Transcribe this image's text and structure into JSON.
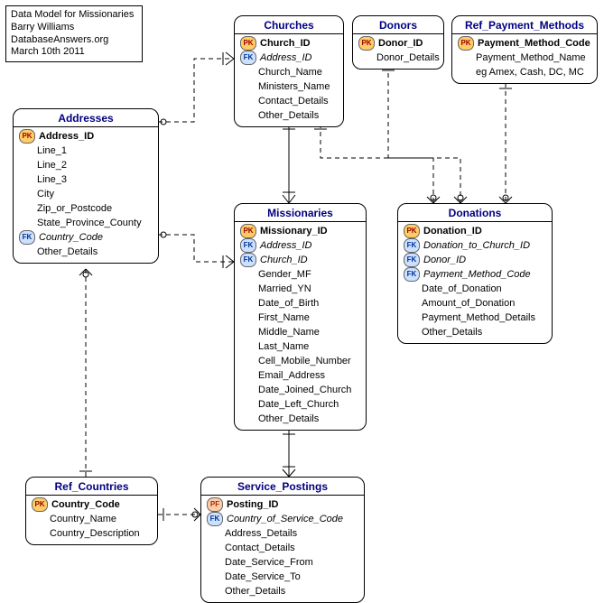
{
  "info": {
    "line1": "Data Model for Missionaries",
    "line2": "Barry Williams",
    "line3": "DatabaseAnswers.org",
    "line4": "March 10th 2011"
  },
  "entities": {
    "churches": {
      "title": "Churches",
      "attrs": [
        {
          "key": "pk",
          "label": "Church_ID",
          "bold": true
        },
        {
          "key": "fk",
          "label": "Address_ID",
          "italic": true
        },
        {
          "key": "",
          "label": "Church_Name"
        },
        {
          "key": "",
          "label": "Ministers_Name"
        },
        {
          "key": "",
          "label": "Contact_Details"
        },
        {
          "key": "",
          "label": "Other_Details"
        }
      ]
    },
    "donors": {
      "title": "Donors",
      "attrs": [
        {
          "key": "pk",
          "label": "Donor_ID",
          "bold": true
        },
        {
          "key": "",
          "label": "Donor_Details"
        }
      ]
    },
    "ref_payment": {
      "title": "Ref_Payment_Methods",
      "attrs": [
        {
          "key": "pk",
          "label": "Payment_Method_Code",
          "bold": true
        },
        {
          "key": "",
          "label": "Payment_Method_Name"
        },
        {
          "key": "",
          "label": "eg Amex, Cash, DC, MC"
        }
      ]
    },
    "addresses": {
      "title": "Addresses",
      "attrs": [
        {
          "key": "pk",
          "label": "Address_ID",
          "bold": true
        },
        {
          "key": "",
          "label": "Line_1"
        },
        {
          "key": "",
          "label": "Line_2"
        },
        {
          "key": "",
          "label": "Line_3"
        },
        {
          "key": "",
          "label": "City"
        },
        {
          "key": "",
          "label": "Zip_or_Postcode"
        },
        {
          "key": "",
          "label": "State_Province_County"
        },
        {
          "key": "fk",
          "label": "Country_Code",
          "italic": true
        },
        {
          "key": "",
          "label": "Other_Details"
        }
      ]
    },
    "missionaries": {
      "title": "Missionaries",
      "attrs": [
        {
          "key": "pk",
          "label": "Missionary_ID",
          "bold": true
        },
        {
          "key": "fk",
          "label": "Address_ID",
          "italic": true
        },
        {
          "key": "fk",
          "label": "Church_ID",
          "italic": true
        },
        {
          "key": "",
          "label": "Gender_MF"
        },
        {
          "key": "",
          "label": "Married_YN"
        },
        {
          "key": "",
          "label": "Date_of_Birth"
        },
        {
          "key": "",
          "label": "First_Name"
        },
        {
          "key": "",
          "label": "Middle_Name"
        },
        {
          "key": "",
          "label": "Last_Name"
        },
        {
          "key": "",
          "label": "Cell_Mobile_Number"
        },
        {
          "key": "",
          "label": "Email_Address"
        },
        {
          "key": "",
          "label": "Date_Joined_Church"
        },
        {
          "key": "",
          "label": "Date_Left_Church"
        },
        {
          "key": "",
          "label": "Other_Details"
        }
      ]
    },
    "donations": {
      "title": "Donations",
      "attrs": [
        {
          "key": "pk",
          "label": "Donation_ID",
          "bold": true
        },
        {
          "key": "fk",
          "label": "Donation_to_Church_ID",
          "italic": true
        },
        {
          "key": "fk",
          "label": "Donor_ID",
          "italic": true
        },
        {
          "key": "fk",
          "label": "Payment_Method_Code",
          "italic": true
        },
        {
          "key": "",
          "label": "Date_of_Donation"
        },
        {
          "key": "",
          "label": "Amount_of_Donation"
        },
        {
          "key": "",
          "label": "Payment_Method_Details"
        },
        {
          "key": "",
          "label": "Other_Details"
        }
      ]
    },
    "ref_countries": {
      "title": "Ref_Countries",
      "attrs": [
        {
          "key": "pk",
          "label": "Country_Code",
          "bold": true
        },
        {
          "key": "",
          "label": "Country_Name"
        },
        {
          "key": "",
          "label": "Country_Description"
        }
      ]
    },
    "service_postings": {
      "title": "Service_Postings",
      "attrs": [
        {
          "key": "pf",
          "label": "Posting_ID",
          "bold": true
        },
        {
          "key": "fk",
          "label": "Country_of_Service_Code",
          "italic": true
        },
        {
          "key": "",
          "label": "Address_Details"
        },
        {
          "key": "",
          "label": "Contact_Details"
        },
        {
          "key": "",
          "label": "Date_Service_From"
        },
        {
          "key": "",
          "label": "Date_Service_To"
        },
        {
          "key": "",
          "label": "Other_Details"
        }
      ]
    }
  }
}
